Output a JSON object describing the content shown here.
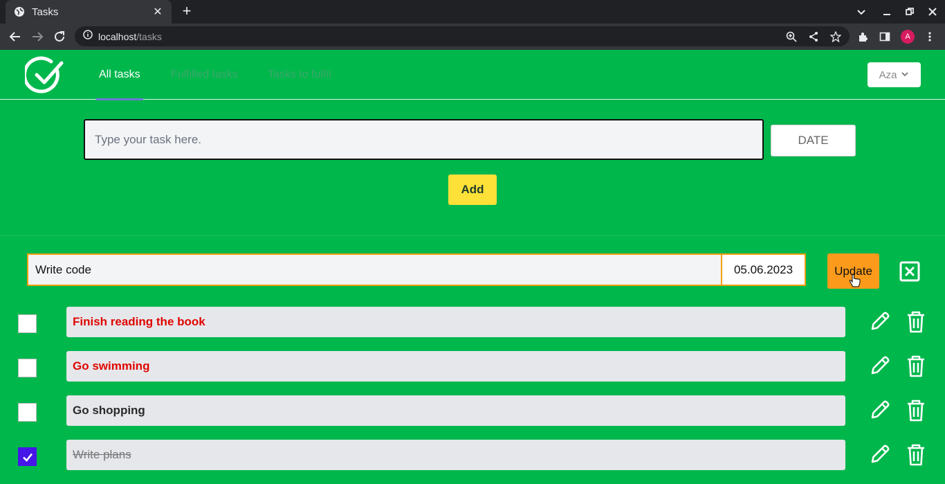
{
  "browser": {
    "tab_title": "Tasks",
    "url_host": "localhost",
    "url_path": "/tasks",
    "profile_initial": "A"
  },
  "nav": {
    "all": "All tasks",
    "fulfilled": "Fulfilled tasks",
    "to_fulfil": "Tasks to fulfil"
  },
  "user": {
    "name": "Aza"
  },
  "new_task": {
    "placeholder": "Type your task here.",
    "date_label": "DATE",
    "add_label": "Add"
  },
  "editing": {
    "text": "Write code",
    "date": "05.06.2023",
    "update_label": "Update"
  },
  "tasks": [
    {
      "text": "Finish reading the book",
      "status": "overdue",
      "checked": false
    },
    {
      "text": "Go swimming",
      "status": "overdue",
      "checked": false
    },
    {
      "text": "Go shopping",
      "status": "pending",
      "checked": false
    },
    {
      "text": "Write plans",
      "status": "done",
      "checked": true
    }
  ],
  "colors": {
    "app_bg": "#00b74c",
    "accent_yellow": "#fde038",
    "accent_orange": "#fb9a1b",
    "overdue_text": "#e10600",
    "checked_box": "#4615e8"
  }
}
